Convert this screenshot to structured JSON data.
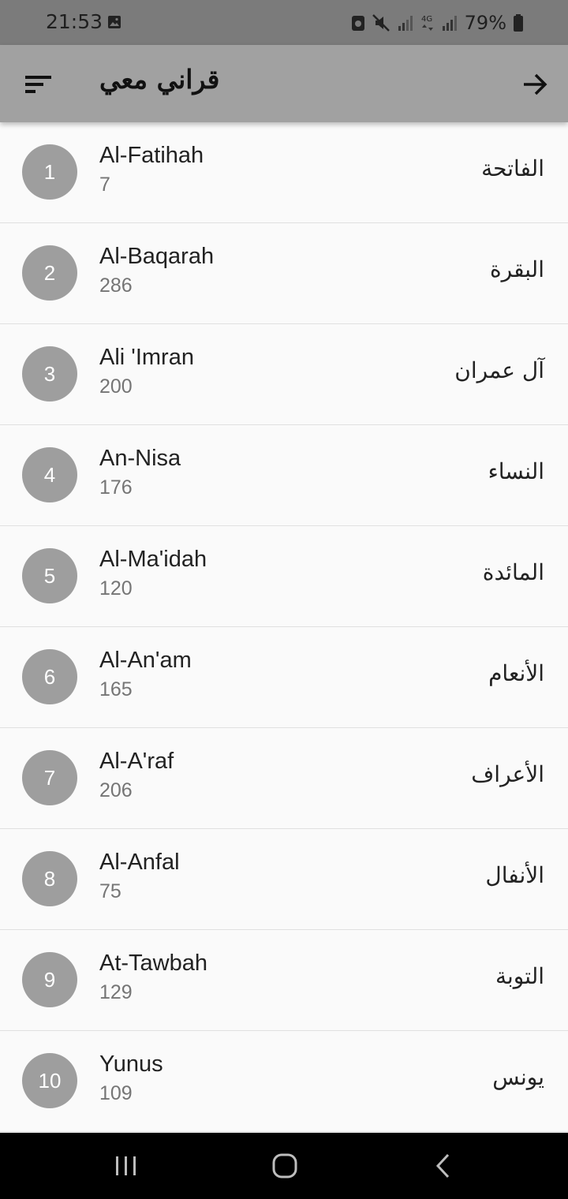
{
  "status_bar": {
    "time": "21:53",
    "battery": "79%",
    "icons": [
      "image-icon",
      "notification-icon",
      "mute-icon",
      "signal-icon",
      "4g-icon",
      "signal-icon",
      "battery-icon"
    ]
  },
  "app_bar": {
    "title": "قراني معي",
    "menu_icon": "sort-menu-icon",
    "action_icon": "arrow-forward-icon"
  },
  "surahs": [
    {
      "number": "1",
      "name": "Al-Fatihah",
      "verses": "7",
      "arabic": "الفاتحة"
    },
    {
      "number": "2",
      "name": "Al-Baqarah",
      "verses": "286",
      "arabic": "البقرة"
    },
    {
      "number": "3",
      "name": "Ali 'Imran",
      "verses": "200",
      "arabic": "آل عمران"
    },
    {
      "number": "4",
      "name": "An-Nisa",
      "verses": "176",
      "arabic": "النساء"
    },
    {
      "number": "5",
      "name": "Al-Ma'idah",
      "verses": "120",
      "arabic": "المائدة"
    },
    {
      "number": "6",
      "name": "Al-An'am",
      "verses": "165",
      "arabic": "الأنعام"
    },
    {
      "number": "7",
      "name": "Al-A'raf",
      "verses": "206",
      "arabic": "الأعراف"
    },
    {
      "number": "8",
      "name": "Al-Anfal",
      "verses": "75",
      "arabic": "الأنفال"
    },
    {
      "number": "9",
      "name": "At-Tawbah",
      "verses": "129",
      "arabic": "التوبة"
    },
    {
      "number": "10",
      "name": "Yunus",
      "verses": "109",
      "arabic": "يونس"
    }
  ],
  "nav_bar": {
    "buttons": [
      "recent-apps-icon",
      "home-icon",
      "back-icon"
    ]
  },
  "colors": {
    "status_bar": "#7b7b7b",
    "app_bar": "#a1a1a1",
    "badge": "#9e9e9e",
    "background": "#fafafa"
  }
}
